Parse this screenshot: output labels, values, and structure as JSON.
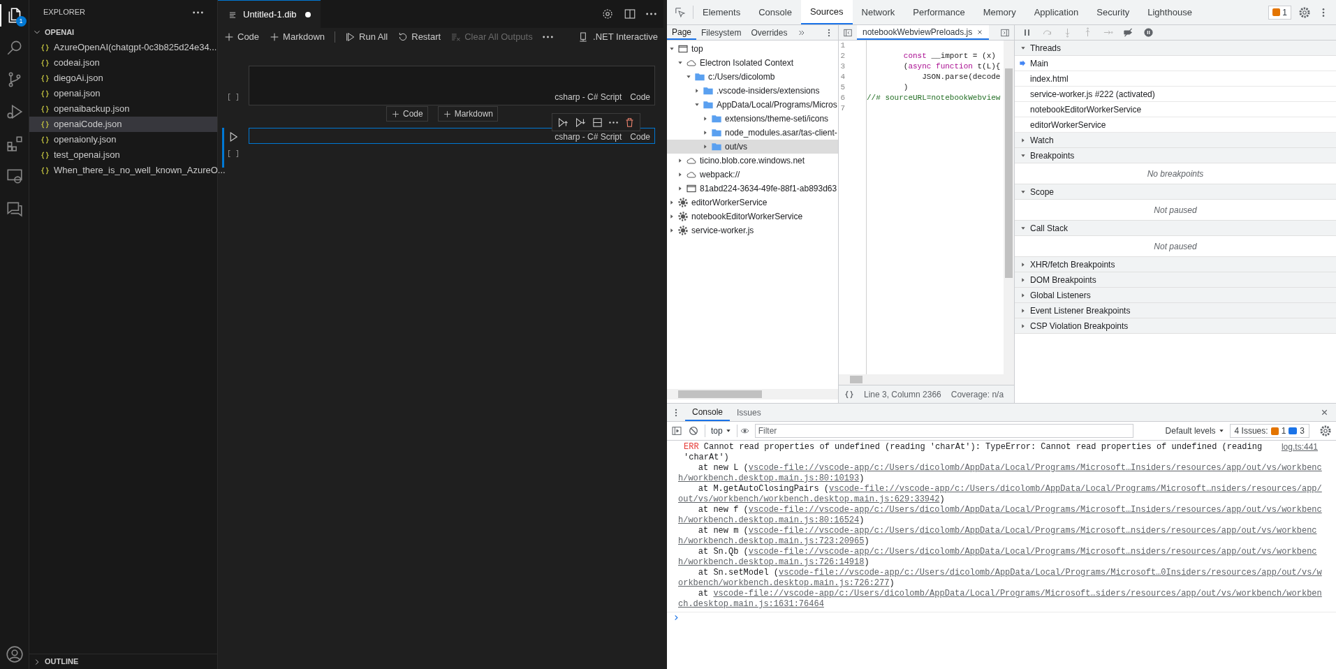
{
  "activity_bar": {
    "items": [
      {
        "selected": true,
        "badge": "1"
      },
      {
        "selected": false
      },
      {
        "selected": false
      },
      {
        "selected": false
      },
      {
        "selected": false
      },
      {
        "selected": false
      },
      {
        "selected": false
      }
    ]
  },
  "sidebar": {
    "title": "EXPLORER",
    "folder": {
      "name": "OPENAI",
      "expanded": true
    },
    "files": [
      {
        "name": "AzureOpenAI(chatgpt-0c3b825d24e34...",
        "selected": false
      },
      {
        "name": "codeai.json",
        "selected": false
      },
      {
        "name": "diegoAi.json",
        "selected": false
      },
      {
        "name": "openai.json",
        "selected": false
      },
      {
        "name": "openaibackup.json",
        "selected": false
      },
      {
        "name": "openaiCode.json",
        "selected": true
      },
      {
        "name": "openaionly.json",
        "selected": false
      },
      {
        "name": "test_openai.json",
        "selected": false
      },
      {
        "name": "When_there_is_no_well_known_AzureO...",
        "selected": false
      }
    ],
    "outline": "OUTLINE"
  },
  "editor": {
    "tab": {
      "title": "Untitled-1.dib",
      "modified": true
    },
    "toolbar": [
      {
        "label": "Code",
        "kind": "add",
        "disabled": false
      },
      {
        "label": "Markdown",
        "kind": "add",
        "disabled": false
      },
      {
        "label": "Run All",
        "kind": "run",
        "disabled": false
      },
      {
        "label": "Restart",
        "kind": "restart",
        "disabled": false
      },
      {
        "label": "Clear All Outputs",
        "kind": "clear",
        "disabled": true
      }
    ],
    "kernel": ".NET Interactive",
    "cells": [
      {
        "execution": "[ ]",
        "language": "csharp - C# Script",
        "type": "Code",
        "focused": false
      },
      {
        "execution": "[ ]",
        "language": "csharp - C# Script",
        "type": "Code",
        "focused": true
      }
    ],
    "insert_buttons": [
      "Code",
      "Markdown"
    ]
  },
  "devtools": {
    "tabs": [
      {
        "label": "Elements",
        "selected": false
      },
      {
        "label": "Console",
        "selected": false
      },
      {
        "label": "Sources",
        "selected": true
      },
      {
        "label": "Network",
        "selected": false
      },
      {
        "label": "Performance",
        "selected": false
      },
      {
        "label": "Memory",
        "selected": false
      },
      {
        "label": "Application",
        "selected": false
      },
      {
        "label": "Security",
        "selected": false
      },
      {
        "label": "Lighthouse",
        "selected": false
      }
    ],
    "issues_badge": "1",
    "sources": {
      "nav_tabs": [
        {
          "label": "Page",
          "selected": true
        },
        {
          "label": "Filesystem",
          "selected": false
        },
        {
          "label": "Overrides",
          "selected": false
        }
      ],
      "tree": [
        {
          "label": "top",
          "kind": "frame",
          "expanded": true,
          "selected": false,
          "children": [
            {
              "label": "Electron Isolated Context",
              "kind": "cloud",
              "expanded": true,
              "selected": false,
              "children": [
                {
                  "label": "c:/Users/dicolomb",
                  "kind": "folder",
                  "expanded": true,
                  "selected": false,
                  "children": [
                    {
                      "label": ".vscode-insiders/extensions",
                      "kind": "folder",
                      "expanded": false,
                      "selected": false
                    },
                    {
                      "label": "AppData/Local/Programs/Micros",
                      "kind": "folder",
                      "expanded": true,
                      "selected": false,
                      "children": [
                        {
                          "label": "extensions/theme-seti/icons",
                          "kind": "folder",
                          "expanded": false,
                          "selected": false
                        },
                        {
                          "label": "node_modules.asar/tas-client-",
                          "kind": "folder",
                          "expanded": false,
                          "selected": false
                        },
                        {
                          "label": "out/vs",
                          "kind": "folder",
                          "expanded": false,
                          "selected": true
                        }
                      ]
                    }
                  ]
                }
              ]
            },
            {
              "label": "ticino.blob.core.windows.net",
              "kind": "cloud",
              "expanded": false,
              "selected": false
            },
            {
              "label": "webpack://",
              "kind": "cloud",
              "expanded": false,
              "selected": false
            },
            {
              "label": "81abd224-3634-49fe-88f1-ab893d63",
              "kind": "frame",
              "expanded": false,
              "selected": false
            }
          ]
        },
        {
          "label": "editorWorkerService",
          "kind": "worker",
          "expanded": false,
          "selected": false
        },
        {
          "label": "notebookEditorWorkerService",
          "kind": "worker",
          "expanded": false,
          "selected": false
        },
        {
          "label": "service-worker.js",
          "kind": "worker",
          "expanded": false,
          "selected": false
        }
      ],
      "file_tab": "notebookWebviewPreloads.js",
      "code": [
        {
          "number": "1"
        },
        {
          "number": "2",
          "segments": [
            {
              "text": "        const",
              "kind": "keyword"
            },
            {
              "text": " __import = (x)",
              "kind": "plain"
            }
          ]
        },
        {
          "number": "3",
          "segments": [
            {
              "text": "        (",
              "kind": "plain"
            },
            {
              "text": "async function",
              "kind": "keyword"
            },
            {
              "text": " t(L){",
              "kind": "plain"
            }
          ]
        },
        {
          "number": "4",
          "segments": [
            {
              "text": "            JSON.parse(decode",
              "kind": "plain"
            }
          ]
        },
        {
          "number": "5",
          "segments": [
            {
              "text": "        )",
              "kind": "plain"
            }
          ]
        },
        {
          "number": "6",
          "segments": [
            {
              "text": "//# sourceURL=notebookWebview",
              "kind": "comment"
            }
          ]
        },
        {
          "number": "7"
        }
      ],
      "status": {
        "position": "Line 3, Column 2366",
        "coverage": "Coverage: n/a"
      },
      "debugger": [
        {
          "title": "Threads",
          "expanded": true,
          "items": [
            {
              "label": "Main",
              "current": true
            },
            {
              "label": "index.html",
              "current": false
            },
            {
              "label": "service-worker.js #222 (activated)",
              "current": false
            },
            {
              "label": "notebookEditorWorkerService",
              "current": false
            },
            {
              "label": "editorWorkerService",
              "current": false
            }
          ]
        },
        {
          "title": "Watch",
          "expanded": false
        },
        {
          "title": "Breakpoints",
          "expanded": true,
          "empty": "No breakpoints"
        },
        {
          "title": "Scope",
          "expanded": true,
          "empty": "Not paused"
        },
        {
          "title": "Call Stack",
          "expanded": true,
          "empty": "Not paused"
        },
        {
          "title": "XHR/fetch Breakpoints",
          "expanded": false
        },
        {
          "title": "DOM Breakpoints",
          "expanded": false
        },
        {
          "title": "Global Listeners",
          "expanded": false
        },
        {
          "title": "Event Listener Breakpoints",
          "expanded": false
        },
        {
          "title": "CSP Violation Breakpoints",
          "expanded": false
        }
      ]
    },
    "console": {
      "tabs": [
        {
          "label": "Console",
          "selected": true
        },
        {
          "label": "Issues",
          "selected": false
        }
      ],
      "context": "top",
      "filter_placeholder": "Filter",
      "levels": "Default levels",
      "issues": {
        "label": "4 Issues:",
        "warnings": "1",
        "infos": "3"
      },
      "messages": [
        {
          "level": "ERR",
          "text": "Cannot read properties of undefined (reading 'charAt'): TypeError: Cannot read properties of undefined (reading 'charAt')",
          "source": "log.ts:441",
          "frames": [
            {
              "prefix": "at new L (",
              "link": "vscode-file://vscode-app/c:/Users/dicolomb/AppData/Local/Programs/Microsoft…Insiders/resources/app/out/vs/workbench/workbench.desktop.main.js:80:10193",
              "suffix": ")"
            },
            {
              "prefix": "at M.getAutoClosingPairs (",
              "link": "vscode-file://vscode-app/c:/Users/dicolomb/AppData/Local/Programs/Microsoft…nsiders/resources/app/out/vs/workbench/workbench.desktop.main.js:629:33942",
              "suffix": ")"
            },
            {
              "prefix": "at new f (",
              "link": "vscode-file://vscode-app/c:/Users/dicolomb/AppData/Local/Programs/Microsoft…Insiders/resources/app/out/vs/workbench/workbench.desktop.main.js:80:16524",
              "suffix": ")"
            },
            {
              "prefix": "at new m (",
              "link": "vscode-file://vscode-app/c:/Users/dicolomb/AppData/Local/Programs/Microsoft…nsiders/resources/app/out/vs/workbench/workbench.desktop.main.js:723:20965",
              "suffix": ")"
            },
            {
              "prefix": "at Sn.Qb (",
              "link": "vscode-file://vscode-app/c:/Users/dicolomb/AppData/Local/Programs/Microsoft…nsiders/resources/app/out/vs/workbench/workbench.desktop.main.js:726:14918",
              "suffix": ")"
            },
            {
              "prefix": "at Sn.setModel (",
              "link": "vscode-file://vscode-app/c:/Users/dicolomb/AppData/Local/Programs/Microsoft…0Insiders/resources/app/out/vs/workbench/workbench.desktop.main.js:726:277",
              "suffix": ")"
            },
            {
              "prefix": "at ",
              "link": "vscode-file://vscode-app/c:/Users/dicolomb/AppData/Local/Programs/Microsoft…siders/resources/app/out/vs/workbench/workbench.desktop.main.js:1631:76464"
            }
          ]
        }
      ]
    }
  }
}
